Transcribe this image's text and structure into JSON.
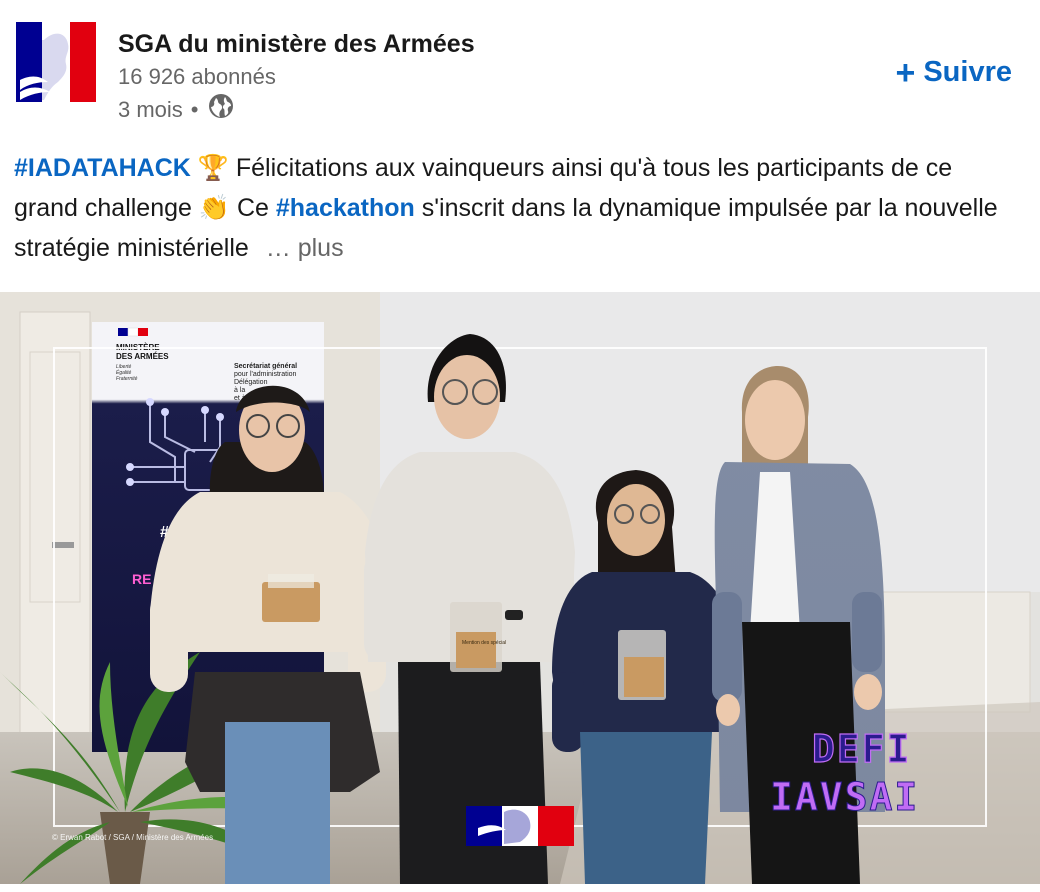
{
  "author": {
    "name": "SGA du ministère des Armées",
    "followers": "16 926 abonnés",
    "time": "3 mois",
    "separator": "•"
  },
  "follow": {
    "icon": "plus-icon",
    "label": "Suivre"
  },
  "post": {
    "hashtag1": "#IADATAHACK",
    "emoji1": "🏆",
    "segment1": " Félicitations aux vainqueurs ainsi qu'à tous les participants de ce grand challenge ",
    "emoji2": "👏",
    "segment2": " Ce ",
    "hashtag2": "#hackathon",
    "segment3": " s'inscrit dans la dynamique impulsée par la nouvelle stratégie ministérielle ",
    "more": "… plus"
  },
  "image": {
    "banner_lines": [
      "MINISTÈRE",
      "DES ARMÉES"
    ],
    "banner_motto": [
      "Liberté",
      "Égalité",
      "Fraternité"
    ],
    "banner_right": [
      "Secrétariat général",
      "pour l'administration",
      "Délégation",
      "à la",
      "et à la"
    ],
    "banner_fragments": [
      "#",
      "RE"
    ],
    "award_label": "Mention des spécial",
    "defi_line1": "DEFI",
    "defi_line2": "IAVSAI",
    "credit": "© Erwan Rabot / SGA / Ministère des Armées"
  },
  "colors": {
    "link": "#0a66c2",
    "text": "#191919",
    "muted": "#666666",
    "marianne_blue": "#000091",
    "marianne_red": "#e1000f",
    "defi_text": "#2b1b8e",
    "defi_glow": "#c06cf5"
  }
}
